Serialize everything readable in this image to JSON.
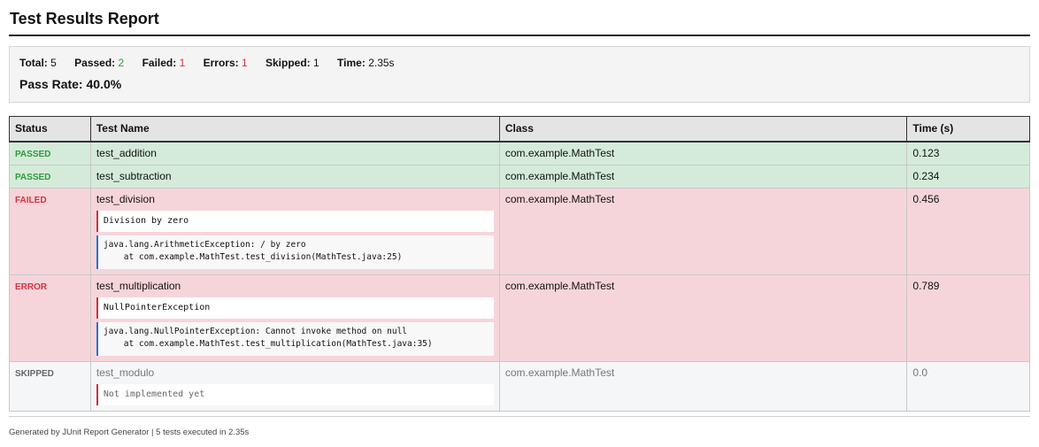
{
  "title": "Test Results Report",
  "summary": {
    "total_label": "Total:",
    "total": "5",
    "passed_label": "Passed:",
    "passed": "2",
    "failed_label": "Failed:",
    "failed": "1",
    "errors_label": "Errors:",
    "errors": "1",
    "skipped_label": "Skipped:",
    "skipped": "1",
    "time_label": "Time:",
    "time": "2.35s",
    "pass_rate": "Pass Rate: 40.0%"
  },
  "table": {
    "headers": [
      "Status",
      "Test Name",
      "Class",
      "Time (s)"
    ],
    "rows": [
      {
        "status": "PASSED",
        "name": "test_addition",
        "class": "com.example.MathTest",
        "time": "0.123"
      },
      {
        "status": "PASSED",
        "name": "test_subtraction",
        "class": "com.example.MathTest",
        "time": "0.234"
      },
      {
        "status": "FAILED",
        "name": "test_division",
        "class": "com.example.MathTest",
        "time": "0.456",
        "message": "Division by zero",
        "trace": "java.lang.ArithmeticException: / by zero\n    at com.example.MathTest.test_division(MathTest.java:25)"
      },
      {
        "status": "ERROR",
        "name": "test_multiplication",
        "class": "com.example.MathTest",
        "time": "0.789",
        "message": "NullPointerException",
        "trace": "java.lang.NullPointerException: Cannot invoke method on null\n    at com.example.MathTest.test_multiplication(MathTest.java:35)"
      },
      {
        "status": "SKIPPED",
        "name": "test_modulo",
        "class": "com.example.MathTest",
        "time": "0.0",
        "message": "Not implemented yet"
      }
    ]
  },
  "colors": {
    "passed_row": "#d5ebd9",
    "failed_row": "#f6d5da",
    "skipped_row": "#f5f6f7",
    "pass_text": "#2e9a3e",
    "fail_text": "#d0343f",
    "trace_border": "#2f6fd6"
  },
  "footer": "Generated by JUnit Report Generator | 5 tests executed in 2.35s"
}
